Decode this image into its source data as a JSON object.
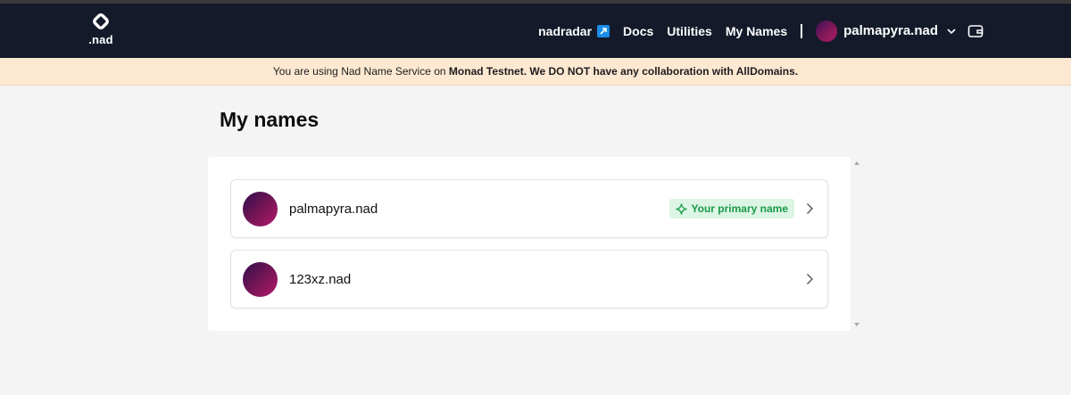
{
  "brand": {
    "logo_text": ".nad",
    "logo_icon": "nad-logo-icon"
  },
  "nav": {
    "links": [
      {
        "label": "nadradar",
        "external": true,
        "icon": "external-link-icon"
      },
      {
        "label": "Docs"
      },
      {
        "label": "Utilities"
      },
      {
        "label": "My Names"
      }
    ],
    "account_name": "palmapyra.nad",
    "dropdown_icon": "chevron-down-icon",
    "wallet_icon": "wallet-icon"
  },
  "notice": {
    "prefix": "You are using Nad Name Service on ",
    "network": "Monad Testnet",
    "separator": ". ",
    "warning": "We DO NOT have any collaboration with AllDomains."
  },
  "page": {
    "title": "My names"
  },
  "names": [
    {
      "name": "palmapyra.nad",
      "primary": true,
      "badge_label": "Your primary name"
    },
    {
      "name": "123xz.nad",
      "primary": false
    }
  ],
  "colors": {
    "navbar_bg": "#141a2a",
    "notice_bg": "#fde8d2",
    "badge_bg": "#dcf5e4",
    "badge_text": "#1b9a48",
    "external_badge": "#1a8ee8"
  }
}
